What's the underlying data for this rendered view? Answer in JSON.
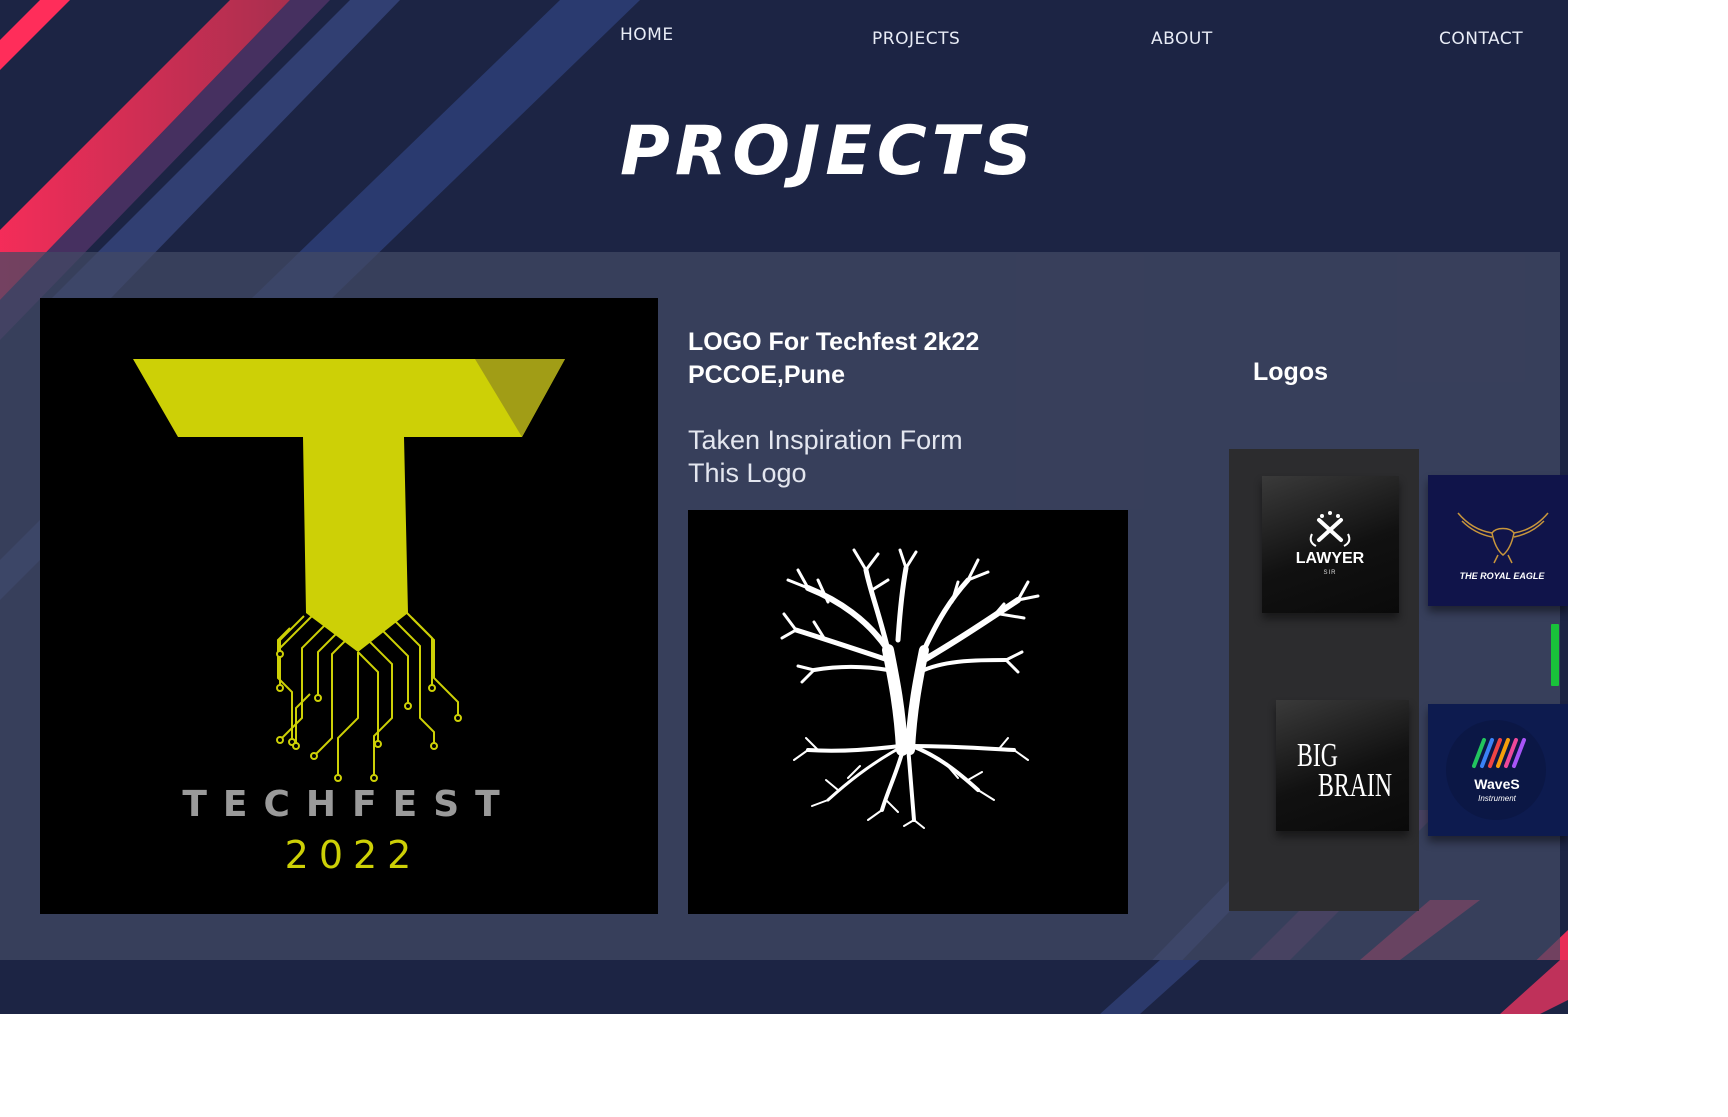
{
  "nav": {
    "home": "HOME",
    "projects": "PROJECTS",
    "about": "ABOUT",
    "contact": "CONTACT"
  },
  "page_title": "PROJECTS",
  "project": {
    "title_line1": "LOGO For Techfest 2k22",
    "title_line2": "PCCOE,Pune",
    "desc_line1": "Taken Inspiration Form",
    "desc_line2": "This Logo"
  },
  "main_image": {
    "word": "TECHFEST",
    "year": "2022"
  },
  "logos": {
    "heading": "Logos",
    "cards": [
      {
        "name": "LAWYER",
        "sub": "SIR"
      },
      {
        "name": "THE ROYAL EAGLE"
      },
      {
        "name_line1": "BIG",
        "name_line2": "BRAIN"
      },
      {
        "name": "WaveS",
        "sub": "Instrument"
      }
    ]
  },
  "colors": {
    "background": "#1c2444",
    "panel": "#434a64",
    "accent_pink": "#ff2a55",
    "accent_yellow": "#cdd006",
    "scroll_indicator": "#19c23a"
  }
}
